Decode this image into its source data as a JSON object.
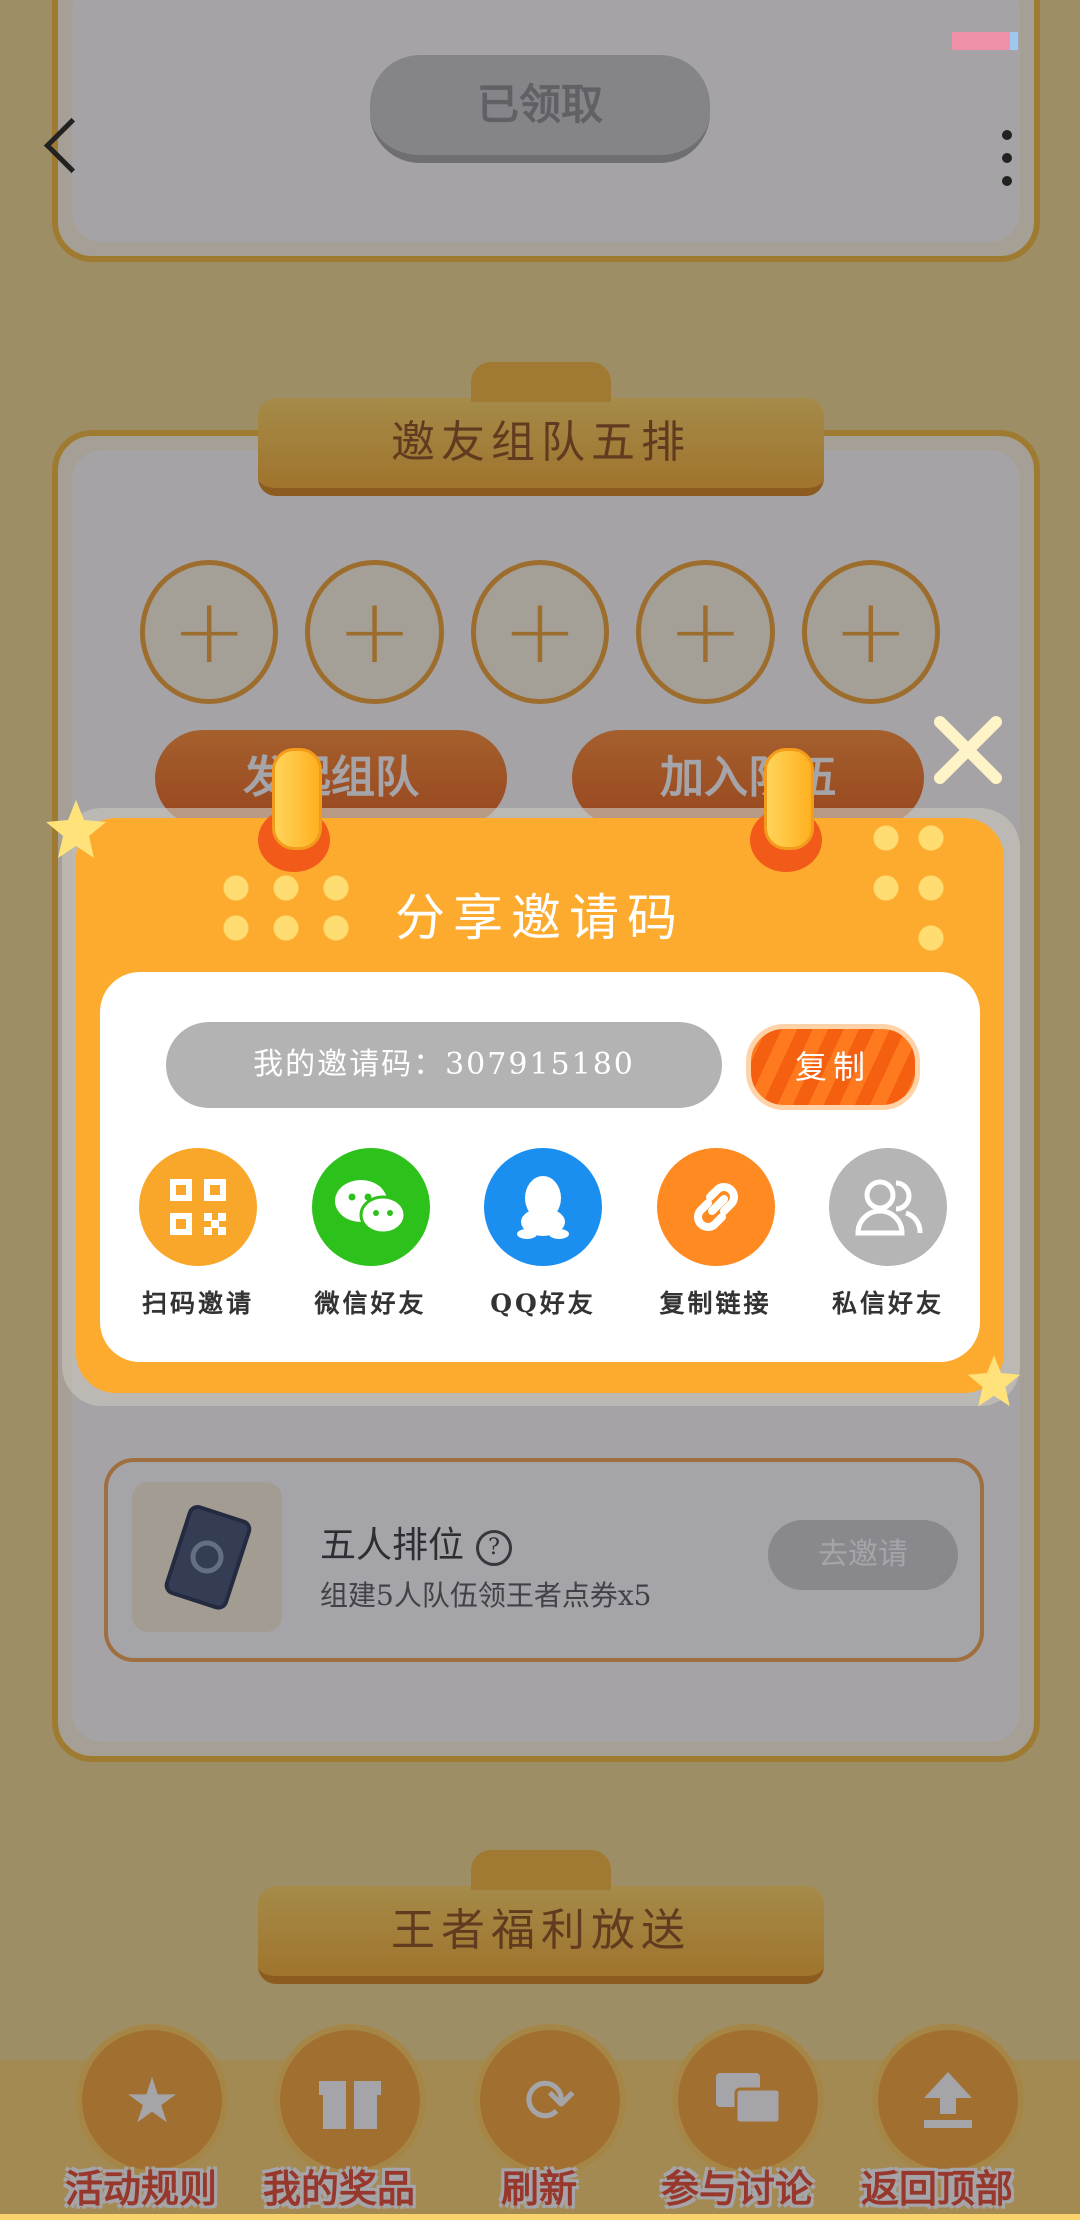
{
  "top_card": {
    "claimed_label": "已领取"
  },
  "team_section": {
    "banner": "邀友组队五排",
    "slot_symbol": "+",
    "buttons": {
      "create": "发起组队",
      "join": "加入队伍"
    }
  },
  "task": {
    "title": "五人排位",
    "help_symbol": "?",
    "description": "组建5人队伍领王者点券x5",
    "button": "去邀请"
  },
  "welfare_section": {
    "banner": "王者福利放送"
  },
  "bottom_nav": [
    {
      "label": "活动规则",
      "icon": "star-icon"
    },
    {
      "label": "我的奖品",
      "icon": "gift-icon"
    },
    {
      "label": "刷新",
      "icon": "refresh-icon"
    },
    {
      "label": "参与讨论",
      "icon": "chat-icon"
    },
    {
      "label": "返回顶部",
      "icon": "upload-icon"
    }
  ],
  "modal": {
    "title": "分享邀请码",
    "invite_code_text": "我的邀请码：307915180",
    "copy_label": "复制",
    "share_options": [
      {
        "label": "扫码邀请",
        "icon": "qrcode-icon",
        "color": "#f9a72a"
      },
      {
        "label": "微信好友",
        "icon": "wechat-icon",
        "color": "#2dc11b"
      },
      {
        "label": "QQ好友",
        "icon": "qq-icon",
        "color": "#1a8ff0"
      },
      {
        "label": "复制链接",
        "icon": "link-icon",
        "color": "#ff8a22"
      },
      {
        "label": "私信好友",
        "icon": "friends-icon",
        "color": "#b5b5b5"
      }
    ]
  },
  "colors": {
    "modal_orange": "#fdab2e",
    "copy_button": "#f55f10",
    "bottom_label_red": "#e8452a"
  }
}
